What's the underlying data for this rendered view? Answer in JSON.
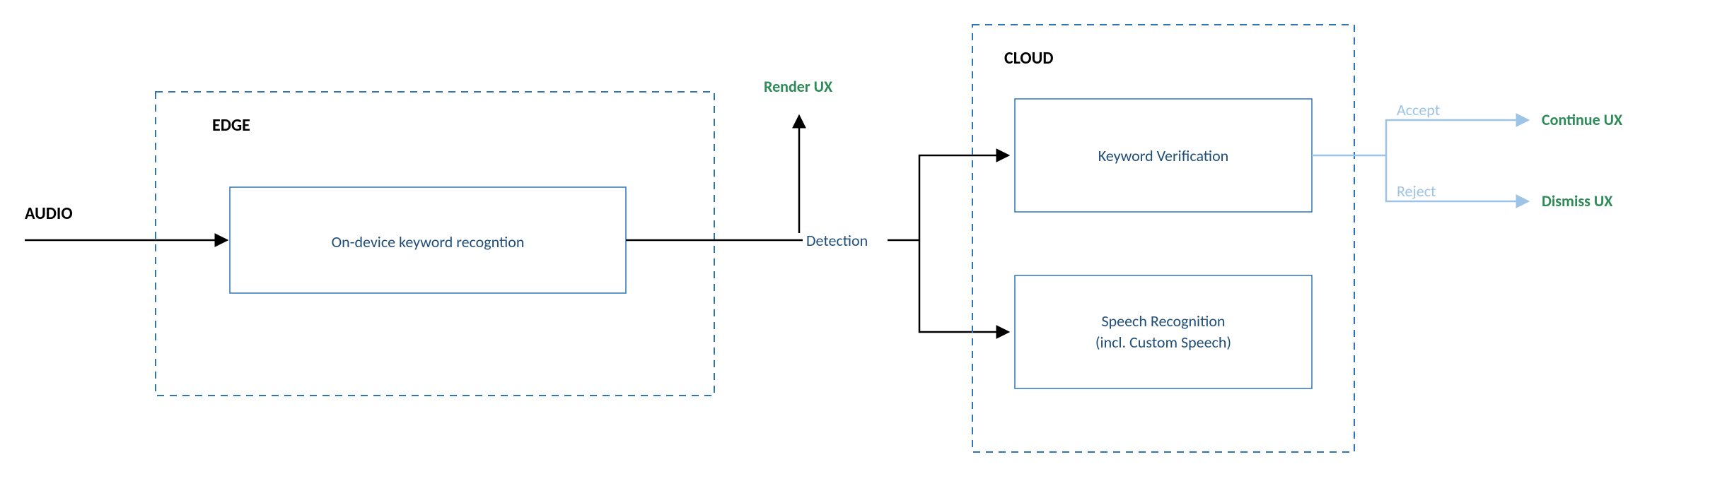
{
  "labels": {
    "audio": "AUDIO",
    "edge": "EDGE",
    "onDevice": "On-device keyword recogntion",
    "renderUX": "Render UX",
    "detection": "Detection",
    "cloud": "CLOUD",
    "keywordVerification": "Keyword Verification",
    "speechRec1": "Speech Recognition",
    "speechRec2": "(incl. Custom Speech)",
    "accept": "Accept",
    "reject": "Reject",
    "continueUX": "Continue UX",
    "dismissUX": "Dismiss UX"
  },
  "colors": {
    "dashedBlue": "#2e75b6",
    "darkBlue": "#1f4e79",
    "green": "#2e8b57",
    "lightBlue": "#9dc3e6",
    "black": "#000000"
  }
}
